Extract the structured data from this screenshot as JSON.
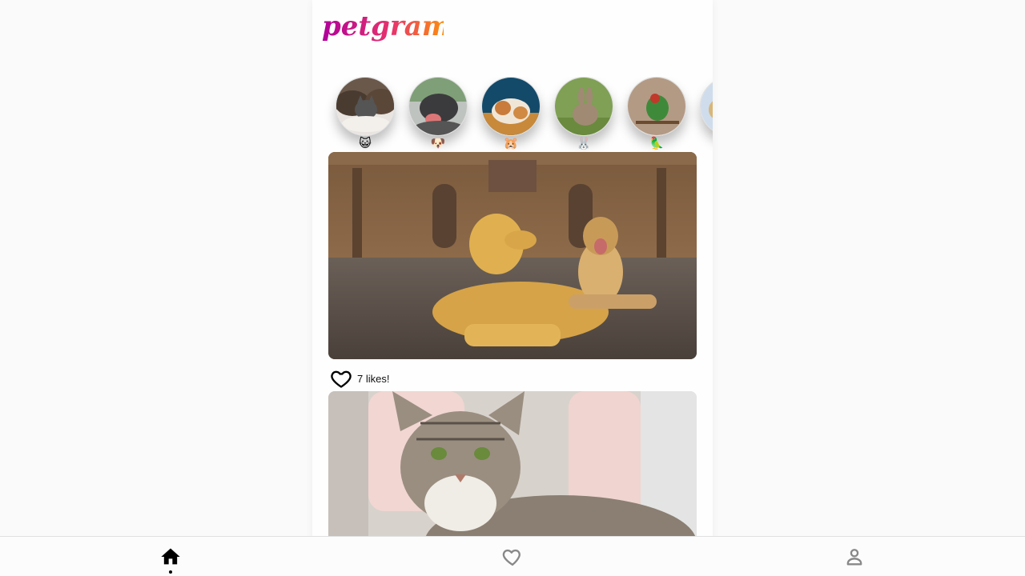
{
  "app": {
    "brand": "petgram"
  },
  "stories": [
    {
      "emoji": "😺",
      "icon": "cat-story"
    },
    {
      "emoji": "🐶",
      "icon": "dog-story"
    },
    {
      "emoji": "🐹",
      "icon": "hamster-story"
    },
    {
      "emoji": "🐰",
      "icon": "rabbit-story"
    },
    {
      "emoji": "🦜",
      "icon": "parrot-story"
    },
    {
      "emoji": "",
      "icon": "partial-story"
    }
  ],
  "feed": [
    {
      "photo": "dogs-lying-in-plaza",
      "likes_text": "7 likes!"
    },
    {
      "photo": "tabby-cat-on-couch"
    }
  ],
  "nav": {
    "items": [
      {
        "name": "home",
        "icon": "home-icon",
        "active": true
      },
      {
        "name": "favorites",
        "icon": "heart-icon",
        "active": false
      },
      {
        "name": "user",
        "icon": "user-icon",
        "active": false
      }
    ]
  },
  "colors": {
    "brand_start": "#b0009b",
    "brand_end": "#ff8a00",
    "icon_active": "#000000",
    "icon_inactive": "#888888"
  }
}
